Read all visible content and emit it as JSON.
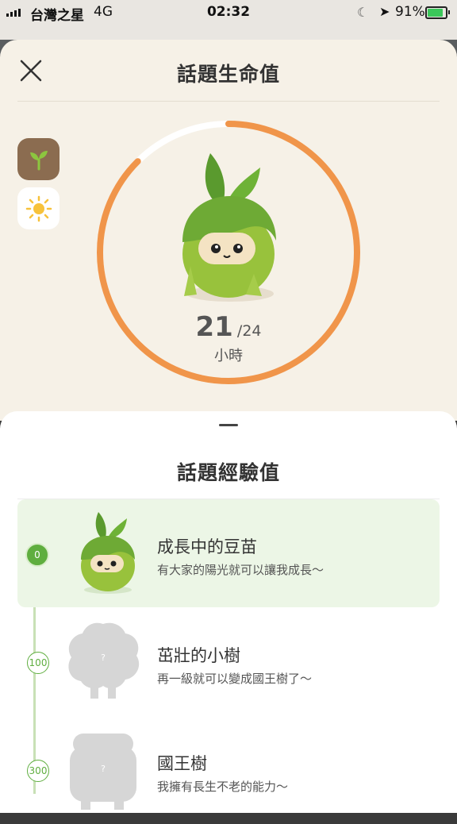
{
  "status_bar": {
    "carrier": "台灣之星",
    "network": "4G",
    "time": "02:32",
    "battery_percent": "91%"
  },
  "header": {
    "title": "話題生命值"
  },
  "life": {
    "current": "21",
    "max_label": "/24",
    "unit": "小時",
    "fraction": 0.875
  },
  "side_tabs": [
    {
      "icon": "sprout-icon",
      "selected": true
    },
    {
      "icon": "sun-icon",
      "selected": false
    }
  ],
  "experience": {
    "title": "話題經驗值",
    "levels": [
      {
        "threshold": "0",
        "name": "成長中的豆苗",
        "desc": "有大家的陽光就可以讓我成長～",
        "active": true
      },
      {
        "threshold": "100",
        "name": "茁壯的小樹",
        "desc": "再一級就可以變成國王樹了～",
        "active": false
      },
      {
        "threshold": "300",
        "name": "國王樹",
        "desc": "我擁有長生不老的能力～",
        "active": false
      }
    ]
  },
  "colors": {
    "ring_progress": "#f0954a",
    "ring_track": "#ffffff",
    "sheet_bg": "#f6f1e7",
    "active_level_bg": "#ecf6e6",
    "accent_green": "#5fae3f"
  }
}
